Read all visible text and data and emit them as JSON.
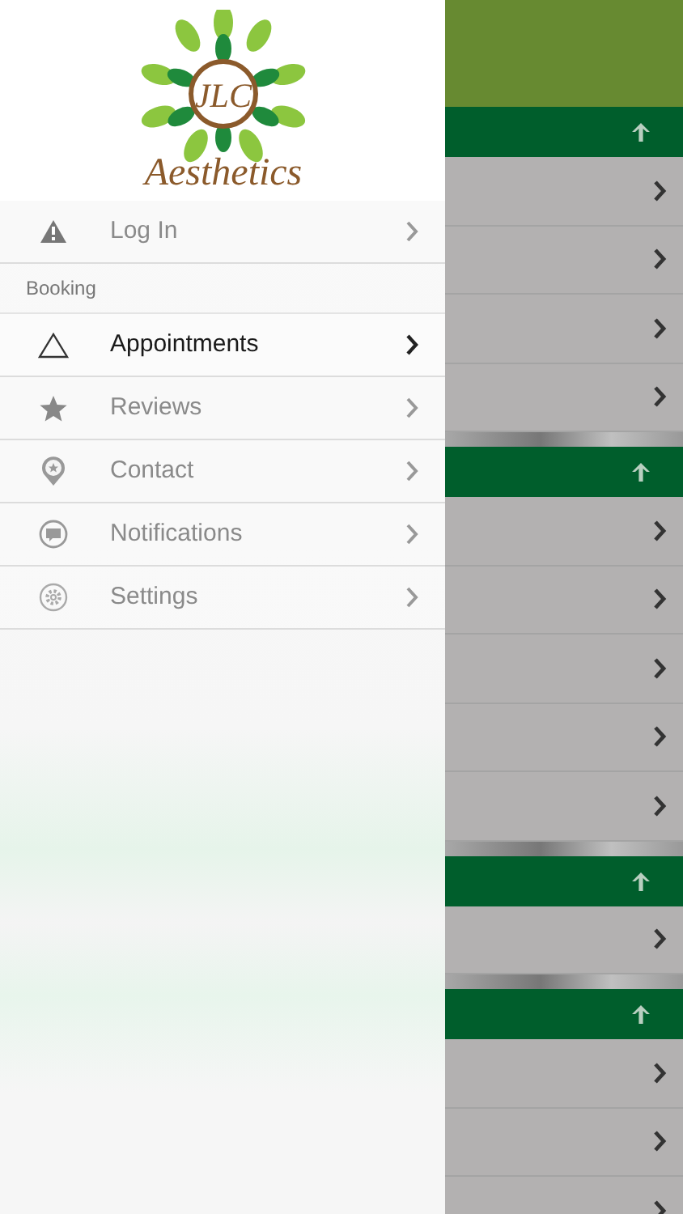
{
  "logo": {
    "monogram": "JLC",
    "wordmark": "Aesthetics"
  },
  "menu_sections": [
    {
      "items": [
        {
          "label": "Log In",
          "selected": false
        }
      ]
    },
    {
      "header": "Booking",
      "items": [
        {
          "label": "Appointments",
          "selected": true
        },
        {
          "label": "Reviews",
          "selected": false
        },
        {
          "label": "Contact",
          "selected": false
        },
        {
          "label": "Notifications",
          "selected": false
        },
        {
          "label": "Settings",
          "selected": false
        }
      ]
    }
  ],
  "background_list": {
    "sections": [
      {
        "rows": [
          {
            "kind": "link"
          },
          {
            "kind": "link"
          },
          {
            "kind": "link"
          },
          {
            "kind": "link"
          }
        ]
      },
      {
        "rows": [
          {
            "kind": "link"
          },
          {
            "kind": "link"
          },
          {
            "kind": "link"
          },
          {
            "kind": "link"
          },
          {
            "kind": "link"
          }
        ]
      },
      {
        "rows": [
          {
            "kind": "link"
          }
        ]
      },
      {
        "rows": [
          {
            "kind": "link"
          },
          {
            "kind": "link"
          },
          {
            "kind": "link"
          }
        ]
      }
    ]
  }
}
